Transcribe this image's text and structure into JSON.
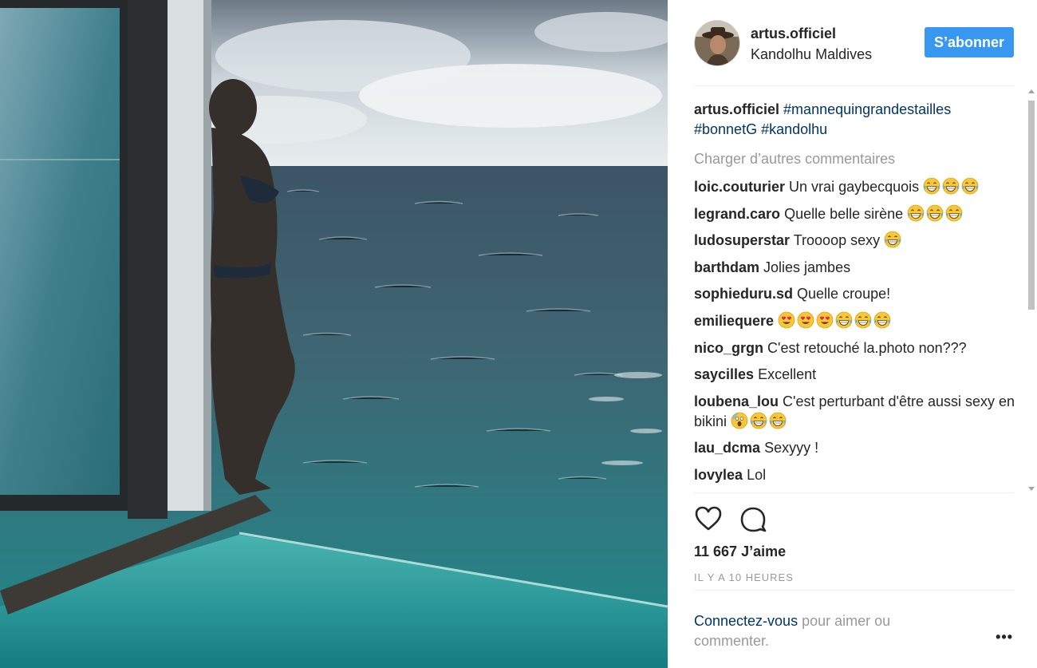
{
  "post": {
    "username": "artus.officiel",
    "location": "Kandolhu Maldives",
    "follow_label": "S’abonner",
    "caption": {
      "user": "artus.officiel",
      "tag1": "#mannequingrandestailles",
      "tag2": "#bonnetG",
      "tag3": "#kandolhu"
    },
    "load_more": "Charger d’autres commentaires",
    "comments": [
      {
        "user": "loic.couturier",
        "text": "Un vrai gaybecquois",
        "emojis": [
          "grin-sweat",
          "grin-sweat",
          "grin-sweat"
        ]
      },
      {
        "user": "legrand.caro",
        "text": "Quelle belle sirène",
        "emojis": [
          "grin-sweat",
          "grin-sweat",
          "grin-sweat"
        ]
      },
      {
        "user": "ludosuperstar",
        "text": "Troooop sexy",
        "emojis": [
          "grin-sweat"
        ]
      },
      {
        "user": "barthdam",
        "text": "Jolies jambes",
        "emojis": []
      },
      {
        "user": "sophieduru.sd",
        "text": "Quelle croupe!",
        "emojis": []
      },
      {
        "user": "emiliequere",
        "text": "",
        "emojis": [
          "heart-eyes",
          "heart-eyes",
          "heart-eyes",
          "grin-sweat",
          "grin-sweat",
          "grin-sweat"
        ]
      },
      {
        "user": "nico_grgn",
        "text": "C'est retouché la.photo non???",
        "emojis": []
      },
      {
        "user": "saycilles",
        "text": "Excellent",
        "emojis": []
      },
      {
        "user": "loubena_lou",
        "text": "C'est perturbant d'être aussi sexy en bikini",
        "emojis": [
          "scream",
          "grin-sweat",
          "grin-sweat"
        ]
      },
      {
        "user": "lau_dcma",
        "text": "Sexyyy !",
        "emojis": []
      },
      {
        "user": "lovylea",
        "text": "Lol",
        "emojis": []
      }
    ],
    "likes": "11 667 J’aime",
    "time": "IL Y A 10 HEURES",
    "login": {
      "link": "Connectez-vous",
      "rest": "pour aimer ou commenter."
    },
    "more_label": "•••"
  },
  "icons": {
    "like": "heart-outline-icon",
    "comment": "comment-bubble-icon"
  },
  "colors": {
    "follow_button": "#3897f0",
    "hashtag": "#003569",
    "muted": "#999999"
  }
}
